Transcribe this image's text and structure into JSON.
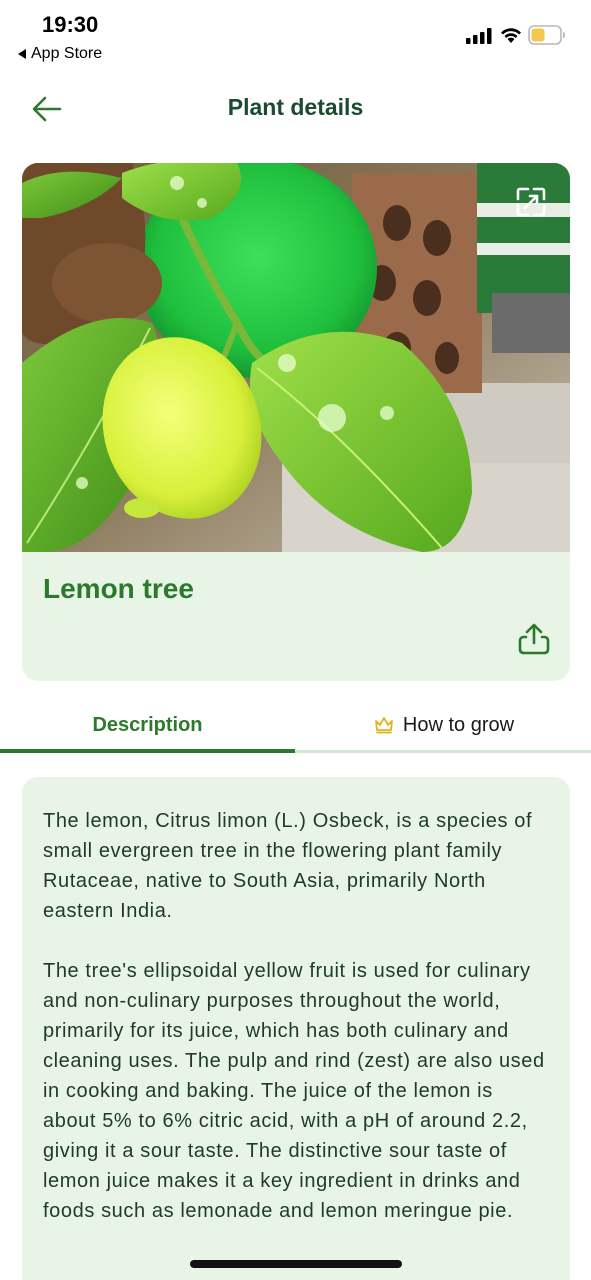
{
  "status_bar": {
    "time": "19:30",
    "back_label": "App Store",
    "battery_color": "#f2c94c"
  },
  "header": {
    "title": "Plant details",
    "back_icon": "arrow-left-icon"
  },
  "plant": {
    "name": "Lemon tree",
    "expand_icon": "expand-icon",
    "share_icon": "share-icon"
  },
  "tabs": [
    {
      "label": "Description",
      "active": true
    },
    {
      "label": "How to grow",
      "active": false,
      "icon": "crown-icon"
    }
  ],
  "description": {
    "paragraphs": [
      "The lemon, Citrus limon (L.) Osbeck, is a species of small evergreen tree in the flowering plant family Rutaceae, native to South Asia, primarily North eastern India.",
      "The tree's ellipsoidal yellow fruit is used for culinary and non-culinary purposes throughout the world, primarily for its juice, which has both culinary and cleaning uses. The pulp and rind (zest) are also used in cooking and baking. The juice of the lemon is about 5% to 6% citric acid, with a pH of around 2.2, giving it a sour taste. The distinctive sour taste of lemon juice makes it a key ingredient in drinks and foods such as lemonade and lemon meringue pie."
    ]
  },
  "colors": {
    "accent": "#2b7a2b",
    "card_background": "#e7f4e6",
    "title_text": "#1c4a2f"
  }
}
